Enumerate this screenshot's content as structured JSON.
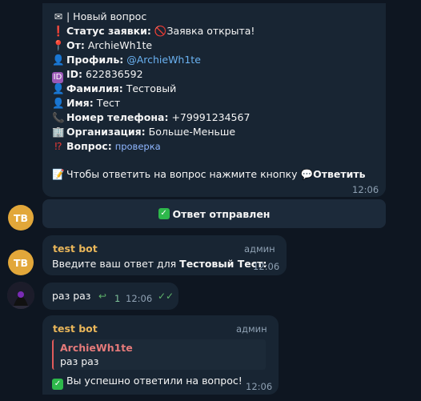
{
  "card": {
    "header": "| Новый вопрос",
    "status_label": "Статус заявки:",
    "status_value": "Заявка открыта!",
    "from_label": "От:",
    "from_value": "ArchieWh1te",
    "profile_label": "Профиль:",
    "profile_value": "@ArchieWh1te",
    "id_label": "ID:",
    "id_value": "622836592",
    "surname_label": "Фамилия:",
    "surname_value": "Тестовый",
    "name_label": "Имя:",
    "name_value": "Тест",
    "phone_label": "Номер телефона:",
    "phone_value": "+79991234567",
    "org_label": "Организация:",
    "org_value": "Больше-Меньше",
    "question_label": "Вопрос:",
    "question_value": "проверка",
    "hint_text": "Чтобы ответить на вопрос нажмите кнопку",
    "hint_button": "Ответить",
    "time": "12:06"
  },
  "inline_button": {
    "label": "Ответ отправлен"
  },
  "avatar_initials": "TB",
  "msg_prompt": {
    "sender": "test bot",
    "role": "админ",
    "text_prefix": "Введите ваш ответ для",
    "text_bold": "Тестовый Тест",
    "text_suffix": ":",
    "time": "12:06"
  },
  "msg_user": {
    "text": "раз раз",
    "reply_count": "1",
    "time": "12:06"
  },
  "msg_confirm": {
    "sender": "test bot",
    "role": "админ",
    "quote_author": "ArchieWh1te",
    "quote_text": "раз раз",
    "text": "Вы успешно ответили на вопрос!",
    "time": "12:06"
  }
}
